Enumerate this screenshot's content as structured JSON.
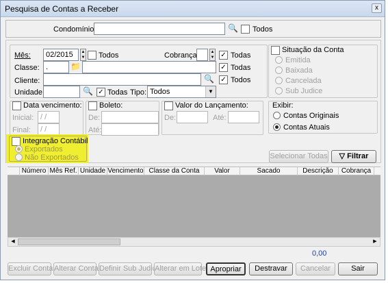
{
  "window": {
    "title": "Pesquisa de Contas a Receber",
    "close": "x"
  },
  "top": {
    "condominio_label": "Condomínio:",
    "condominio_value": "",
    "todos": "Todos"
  },
  "filters": {
    "mes_label": "Mês:",
    "mes_value": "02/2015",
    "mes_todos": "Todos",
    "cobranca_label": "Cobrança:",
    "cobranca_value": "",
    "cobranca_todas": "Todas",
    "classe_label": "Classe:",
    "classe_code": ".",
    "classe_desc": "",
    "classe_todas": "Todas",
    "cliente_label": "Cliente:",
    "cliente_value": "",
    "cliente_todos": "Todos",
    "unidade_label": "Unidade:",
    "unidade_value": "",
    "unidade_todas": "Todas",
    "tipo_label": "Tipo:",
    "tipo_value": "Todos"
  },
  "situacao": {
    "title": "Situação da Conta",
    "options": [
      "Emitida",
      "Baixada",
      "Cancelada",
      "Sub Judice"
    ]
  },
  "vencimento": {
    "title": "Data vencimento:",
    "inicial_label": "Inicial:",
    "inicial_value": "/ /",
    "final_label": "Final:",
    "final_value": "/ /"
  },
  "boleto": {
    "title": "Boleto:",
    "de_label": "De:",
    "ate_label": "Até:",
    "de_value": "",
    "ate_value": ""
  },
  "valor": {
    "title": "Valor do Lançamento:",
    "de_label": "De:",
    "ate_label": "Até:",
    "de_value": "",
    "ate_value": ""
  },
  "exibir": {
    "title": "Exibir:",
    "options": [
      "Contas Originais",
      "Contas Atuais"
    ],
    "selected": "Contas Atuais"
  },
  "integracao": {
    "title": "Integração Contábil",
    "options": [
      "Exportados",
      "Não Exportados"
    ],
    "selected": "Exportados"
  },
  "actions": {
    "selecionar": "Selecionar Todas",
    "filtrar": "Filtrar"
  },
  "grid": {
    "columns": [
      "Número",
      "Mês Ref.",
      "Unidade",
      "Vencimento",
      "Classe da Conta",
      "Valor",
      "Sacado",
      "Descrição",
      "Cobrança"
    ]
  },
  "total": "0,00",
  "footer": [
    "Excluir Conta",
    "Alterar Conta",
    "Definir Sub Judice",
    "Alterar em Lote",
    "Apropriar",
    "Destravar",
    "Cancelar",
    "Sair"
  ],
  "icons": {
    "binoculars": "binoculars-icon",
    "folder": "folder-icon",
    "filter": "funnel-icon"
  },
  "colors": {
    "highlight": "#f0ee30",
    "total": "#2040a0"
  }
}
